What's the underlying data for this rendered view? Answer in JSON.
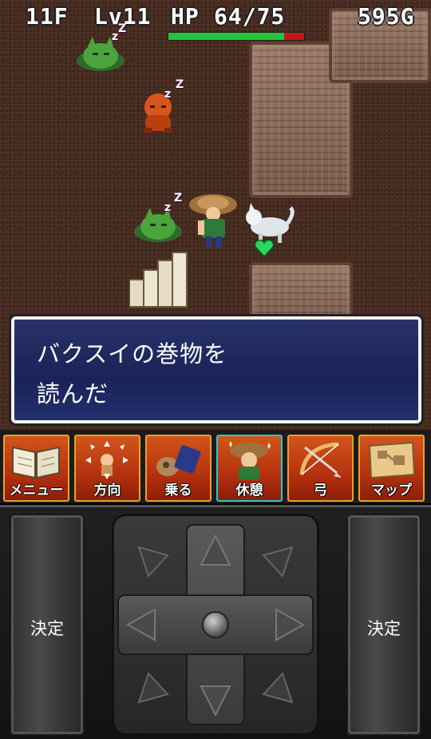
{
  "hud": {
    "floor": "11F",
    "level": "Lv11",
    "hp_label": "HP",
    "hp_value": "64/75",
    "hp_current": 64,
    "hp_max": 75,
    "gold": "595G"
  },
  "message": {
    "line1": "バクスイの巻物を",
    "line2": "読んだ"
  },
  "commands": [
    {
      "label": "メニュー",
      "icon": "book-icon"
    },
    {
      "label": "方向",
      "icon": "direction-icon"
    },
    {
      "label": "乗る",
      "icon": "ride-icon"
    },
    {
      "label": "休憩",
      "icon": "rest-icon"
    },
    {
      "label": "弓",
      "icon": "bow-icon"
    },
    {
      "label": "マップ",
      "icon": "map-icon"
    }
  ],
  "controls": {
    "left_button": "決定",
    "right_button": "決定"
  },
  "sleep_marks": [
    "z",
    "Z"
  ],
  "colors": {
    "hp_fill": "#27c23a",
    "hp_empty": "#c31818",
    "message_bg": "#1a2358",
    "command_bg": "#b5310f",
    "selected_border": "#29c9c9"
  }
}
